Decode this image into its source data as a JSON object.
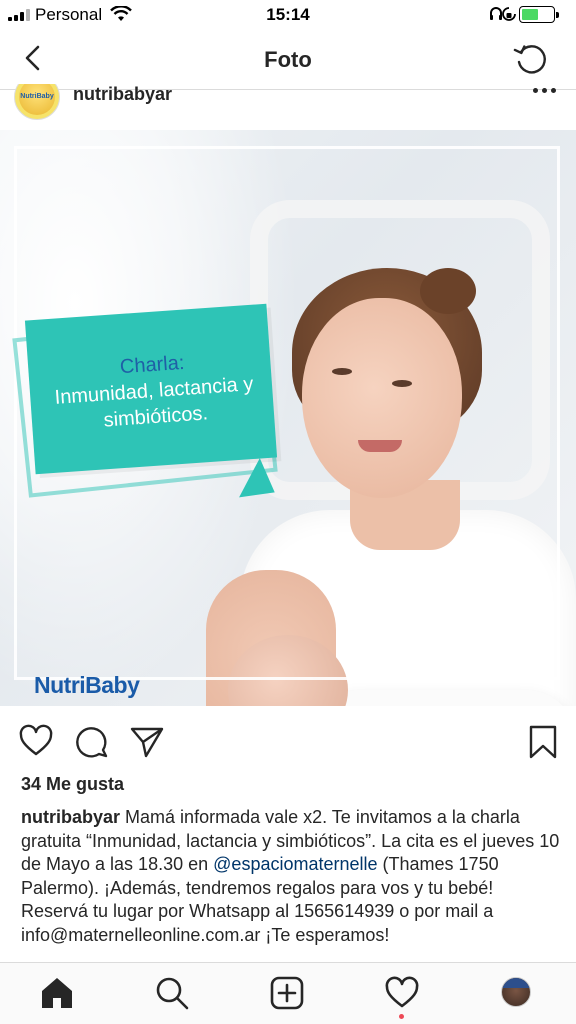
{
  "status_bar": {
    "carrier": "Personal",
    "time": "15:14",
    "battery_level": 0.5,
    "battery_color": "#4cd964"
  },
  "nav": {
    "title": "Foto",
    "back_icon": "chevron-left-icon",
    "refresh_icon": "refresh-icon"
  },
  "post": {
    "username": "nutribabyar",
    "avatar_text": "NutriBaby",
    "image": {
      "bubble_line1": "Charla:",
      "bubble_line2": "Inmunidad, lactancia y",
      "bubble_line3": "simbióticos.",
      "brand": "NutriBaby",
      "bubble_color": "#2ec4b6"
    },
    "likes": "34 Me gusta",
    "caption": {
      "username": "nutribabyar",
      "text_before_mention": "Mamá informada vale x2. Te invitamos a la charla gratuita “Inmunidad, lactancia y simbióticos”. La cita es el jueves 10 de Mayo a las 18.30 en",
      "mention": "@espaciomaternelle",
      "text_after_mention": "(Thames 1750 Palermo). ¡Además, tendremos regalos para vos y tu bebé! Reservá tu lugar por Whatsapp al 1565614939 o por mail a info@maternelleonline.com.ar ¡Te esperamos!"
    }
  },
  "actions": [
    "heart-icon",
    "comment-icon",
    "share-icon",
    "bookmark-icon"
  ],
  "tabbar": [
    "home-icon",
    "search-icon",
    "add-icon",
    "activity-heart-icon",
    "profile-avatar"
  ],
  "colors": {
    "mention": "#003569",
    "notification_dot": "#ed4956",
    "brand_blue": "#1a5ba8"
  }
}
